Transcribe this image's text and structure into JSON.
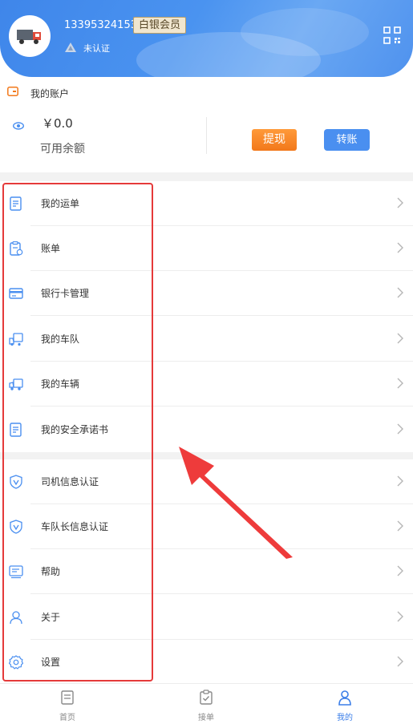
{
  "user": {
    "phone": "13395324153",
    "member_level": "白银会员",
    "verify_status": "未认证"
  },
  "account": {
    "title": "我的账户",
    "balance": "￥0.0",
    "balance_label": "可用余额",
    "withdraw_label": "提现",
    "transfer_label": "转账"
  },
  "menu": [
    {
      "label": "我的运单",
      "icon": "document-icon"
    },
    {
      "label": "账单",
      "icon": "bill-icon"
    },
    {
      "label": "银行卡管理",
      "icon": "bank-card-icon"
    },
    {
      "label": "我的车队",
      "icon": "fleet-icon"
    },
    {
      "label": "我的车辆",
      "icon": "truck-icon"
    },
    {
      "label": "我的安全承诺书",
      "icon": "document-icon"
    },
    {
      "label": "司机信息认证",
      "icon": "shield-icon"
    },
    {
      "label": "车队长信息认证",
      "icon": "shield-icon"
    },
    {
      "label": "帮助",
      "icon": "help-icon"
    },
    {
      "label": "关于",
      "icon": "person-icon"
    },
    {
      "label": "设置",
      "icon": "gear-icon"
    }
  ],
  "tabs": [
    {
      "label": "首页",
      "icon": "home-doc-icon",
      "active": false
    },
    {
      "label": "接单",
      "icon": "checklist-icon",
      "active": false
    },
    {
      "label": "我的",
      "icon": "user-icon",
      "active": true
    }
  ],
  "colors": {
    "header": "#4a8ff0",
    "withdraw": "#f2781a",
    "transfer": "#4a8ff0",
    "highlight": "#e53a3a",
    "active_tab": "#3b7ee8"
  }
}
